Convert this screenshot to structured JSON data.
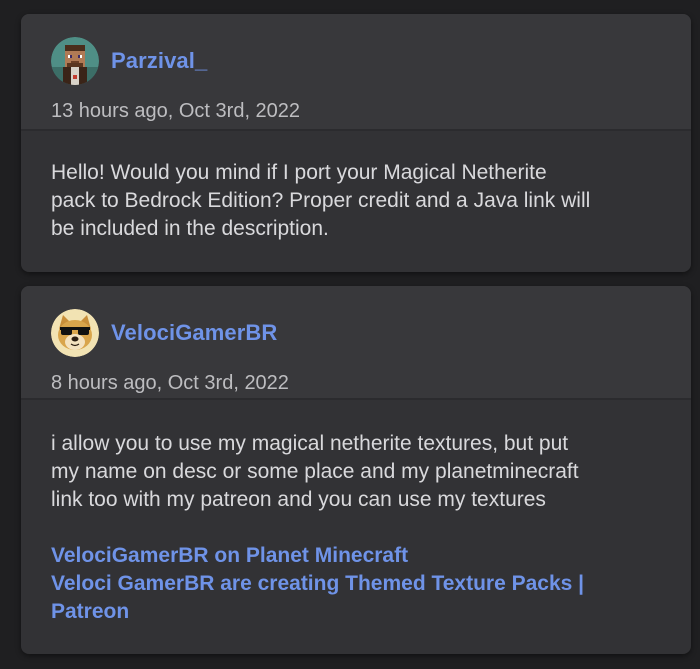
{
  "comments": [
    {
      "author": "Parzival_",
      "avatar_icon": "pixel-steve-avatar-icon",
      "timestamp": "13 hours ago, Oct 3rd, 2022",
      "body_lines": [
        "Hello! Would you mind if I port your Magical Netherite",
        "pack to Bedrock Edition? Proper credit and a Java link will",
        "be included in the description."
      ]
    },
    {
      "author": "VelociGamerBR",
      "avatar_icon": "doge-sunglasses-avatar-icon",
      "timestamp": "8 hours ago, Oct 3rd, 2022",
      "body_lines": [
        "i allow you to use my magical netherite textures, but put",
        "my name on desc or some place and my planetminecraft",
        "link too with my patreon and you can use my textures"
      ],
      "links": [
        "VelociGamerBR on Planet Minecraft",
        "Veloci GamerBR are creating Themed Texture Packs |",
        "Patreon"
      ]
    }
  ],
  "colors": {
    "background": "#1f1f21",
    "card": "#323235",
    "card_header": "#38383b",
    "link": "#6f93e8",
    "body_text": "#d9d9dc",
    "timestamp": "#bdbdc0"
  }
}
